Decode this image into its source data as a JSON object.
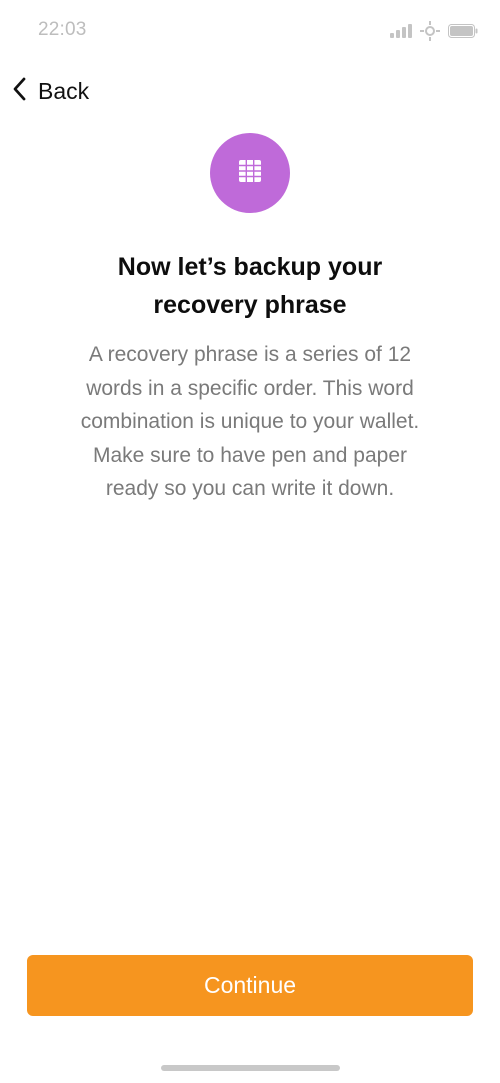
{
  "status_bar": {
    "time": "22:03",
    "icons": [
      "signal-icon",
      "wifi-icon",
      "battery-icon"
    ]
  },
  "nav": {
    "back_label": "Back",
    "back_icon": "chevron-left-icon"
  },
  "hero": {
    "icon": "grid-icon",
    "icon_background": "#bf6ad9"
  },
  "content": {
    "title_line1": "Now let’s backup your",
    "title_line2": "recovery phrase",
    "description_line1": "A recovery phrase is a series of 12",
    "description_line2": "words in a specific order. This word",
    "description_line3": "combination is unique to your wallet.",
    "description_line4": "Make sure to have pen and paper",
    "description_line5": "ready so you can write it down."
  },
  "actions": {
    "continue_label": "Continue",
    "continue_color": "#f6951f"
  }
}
